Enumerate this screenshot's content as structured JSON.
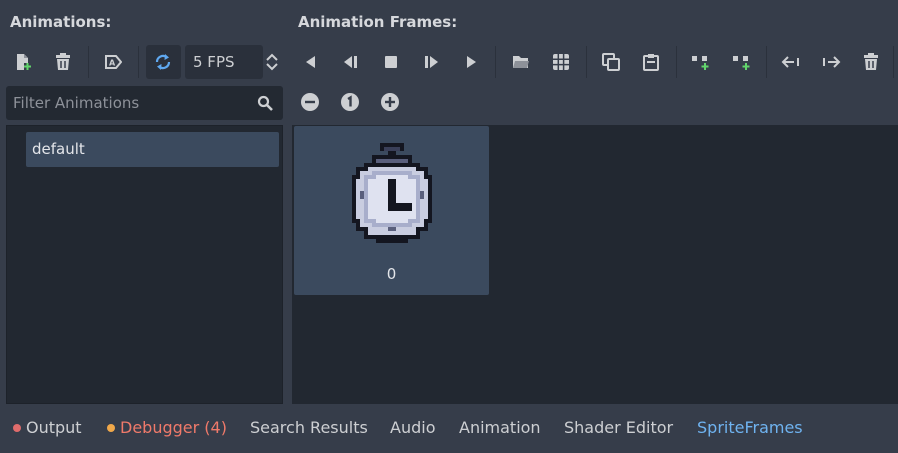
{
  "headings": {
    "animations": "Animations:",
    "frames": "Animation Frames:"
  },
  "fps": {
    "value": "5 FPS"
  },
  "filter": {
    "placeholder": "Filter Animations"
  },
  "animations": {
    "items": [
      {
        "label": "default",
        "selected": true
      }
    ]
  },
  "frames": [
    {
      "label": "0"
    }
  ],
  "bottom_tabs": [
    {
      "label": "Output",
      "dot_color": "#e06c6c"
    },
    {
      "label": "Debugger (4)",
      "dot_color": "#f0a84a",
      "color": "#f07a6a"
    },
    {
      "label": "Search Results"
    },
    {
      "label": "Audio"
    },
    {
      "label": "Animation"
    },
    {
      "label": "Shader Editor"
    },
    {
      "label": "SpriteFrames",
      "color": "#6fb3f0"
    }
  ],
  "colors": {
    "accent": "#5fa8f0",
    "add_green": "#62d56c",
    "panel": "#222831",
    "selected": "#3b4a5e"
  },
  "icons": {
    "toolbar_left": [
      "new-animation-icon",
      "delete-animation-icon",
      "autoplay-icon",
      "loop-icon",
      "fps-stepper-icon"
    ],
    "toolbar_playback": [
      "play-backwards-icon",
      "play-backwards-from-start-icon",
      "stop-icon",
      "play-from-start-icon",
      "play-icon"
    ],
    "toolbar_frames": [
      "load-frames-icon",
      "sprite-sheet-icon",
      "copy-frame-icon",
      "paste-frame-icon",
      "insert-before-icon",
      "insert-after-icon",
      "move-left-icon",
      "move-right-icon",
      "delete-frame-icon"
    ],
    "zoom": [
      "zoom-out-icon",
      "zoom-reset-icon",
      "zoom-in-icon"
    ]
  }
}
